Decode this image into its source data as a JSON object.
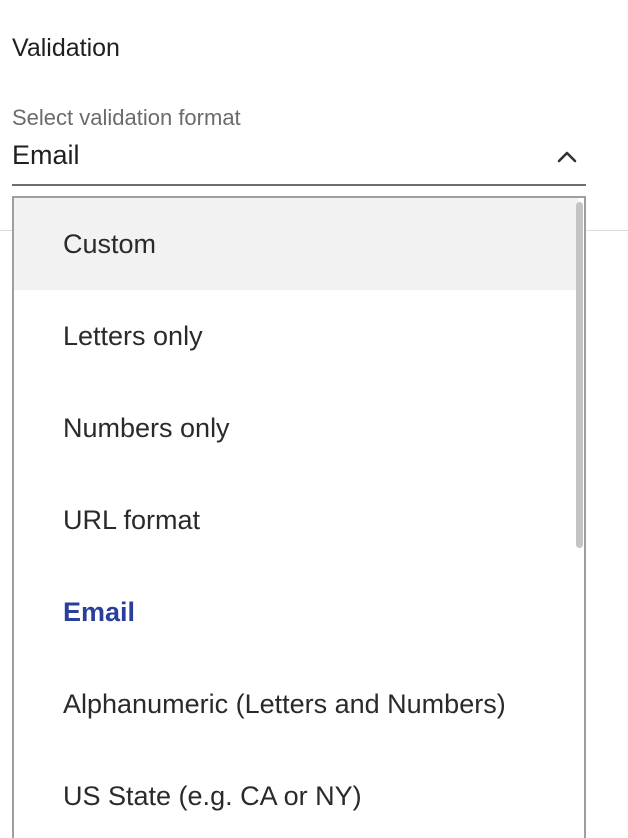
{
  "section": {
    "title": "Validation"
  },
  "select": {
    "label": "Select validation format",
    "value": "Email",
    "chevron_icon": "chevron-up-icon"
  },
  "dropdown": {
    "options": [
      {
        "label": "Custom",
        "state": "hovered"
      },
      {
        "label": "Letters only",
        "state": ""
      },
      {
        "label": "Numbers only",
        "state": ""
      },
      {
        "label": "URL format",
        "state": ""
      },
      {
        "label": "Email",
        "state": "selected"
      },
      {
        "label": "Alphanumeric (Letters and Numbers)",
        "state": ""
      },
      {
        "label": "US State (e.g. CA or NY)",
        "state": ""
      }
    ]
  },
  "colors": {
    "selected_text": "#2a3f9d",
    "hover_bg": "#f2f2f2"
  }
}
